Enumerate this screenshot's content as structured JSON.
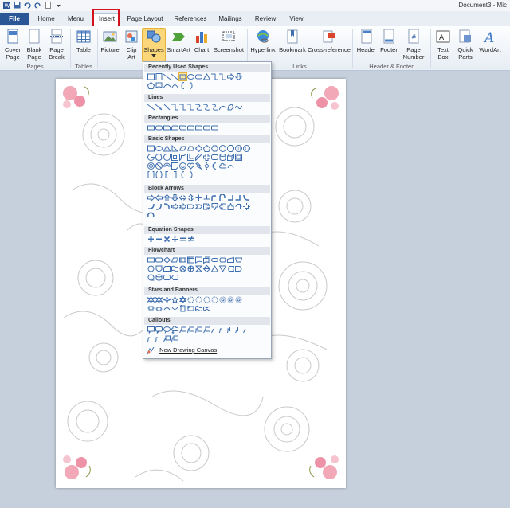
{
  "window": {
    "doc_title": "Document3 - Mic"
  },
  "tabs": [
    {
      "label": "File"
    },
    {
      "label": "Home"
    },
    {
      "label": "Menu"
    },
    {
      "label": "Insert"
    },
    {
      "label": "Page Layout"
    },
    {
      "label": "References"
    },
    {
      "label": "Mailings"
    },
    {
      "label": "Review"
    },
    {
      "label": "View"
    }
  ],
  "ribbon": {
    "buttons": {
      "cover_page": "Cover Page",
      "blank_page": "Blank Page",
      "page_break": "Page Break",
      "table": "Table",
      "picture": "Picture",
      "clip_art": "Clip Art",
      "shapes": "Shapes",
      "smartart": "SmartArt",
      "chart": "Chart",
      "screenshot": "Screenshot",
      "hyperlink": "Hyperlink",
      "bookmark": "Bookmark",
      "cross_reference": "Cross-reference",
      "header": "Header",
      "footer": "Footer",
      "page_number": "Page Number",
      "text_box": "Text Box",
      "quick_parts": "Quick Parts",
      "wordart": "WordArt"
    },
    "groups": {
      "pages": "Pages",
      "tables": "Tables",
      "links": "Links",
      "header_footer": "Header & Footer"
    }
  },
  "gallery": {
    "categories": {
      "recent": "Recently Used Shapes",
      "lines": "Lines",
      "rectangles": "Rectangles",
      "basic": "Basic Shapes",
      "block_arrows": "Block Arrows",
      "equation": "Equation Shapes",
      "flowchart": "Flowchart",
      "stars": "Stars and Banners",
      "callouts": "Callouts"
    },
    "new_canvas": "New Drawing Canvas"
  },
  "colors": {
    "file_tab": "#2b5797",
    "highlight": "#d4111c",
    "selected_button": "#fbd779",
    "shape_blue": "#3f6fb0"
  }
}
